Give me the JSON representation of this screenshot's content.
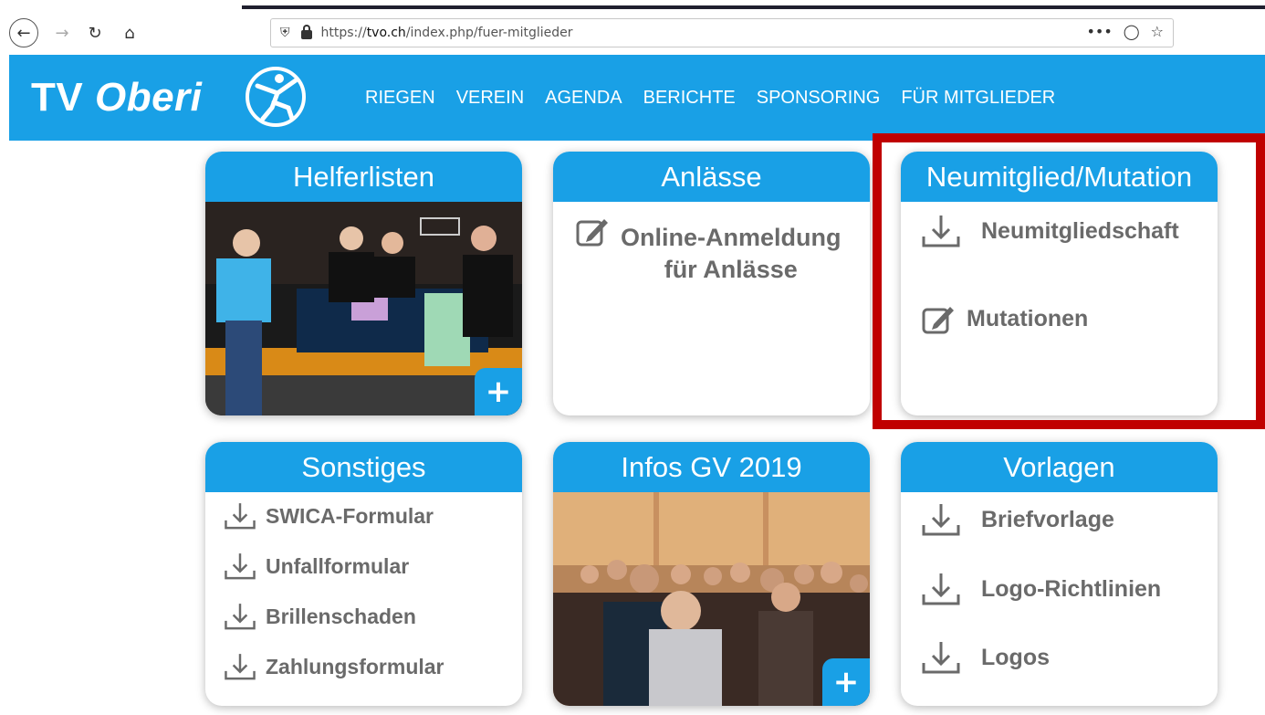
{
  "browser": {
    "url_prefix": "https://",
    "url_domain": "tvo.ch",
    "url_path": "/index.php/fuer-mitglieder",
    "back_icon": "back-arrow-icon",
    "forward_icon": "forward-arrow-icon",
    "reload_icon": "reload-icon",
    "home_icon": "home-icon",
    "menu_label": "•••"
  },
  "site": {
    "logo_tv": "TV",
    "logo_oberi": "Oberi",
    "nav": [
      "RIEGEN",
      "VEREIN",
      "AGENDA",
      "BERICHTE",
      "SPONSORING",
      "FÜR MITGLIEDER"
    ]
  },
  "cards": {
    "helferlisten": {
      "title": "Helferlisten",
      "plus": "+"
    },
    "anlaesse": {
      "title": "Anlässe",
      "item_line1": "Online-Anmeldung",
      "item_line2": "für Anlässe"
    },
    "neumitglied": {
      "title": "Neumitglied/Mutation",
      "item1": "Neumitgliedschaft",
      "item2": "Mutationen"
    },
    "sonstiges": {
      "title": "Sonstiges",
      "items": [
        "SWICA-Formular",
        "Unfallformular",
        "Brillenschaden",
        "Zahlungsformular"
      ]
    },
    "infos": {
      "title": "Infos GV 2019",
      "plus": "+"
    },
    "vorlagen": {
      "title": "Vorlagen",
      "items": [
        "Briefvorlage",
        "Logo-Richtlinien",
        "Logos"
      ]
    }
  },
  "colors": {
    "brand_blue": "#19a0e6",
    "highlight_red": "#c00000",
    "item_gray": "#6a6a6a"
  }
}
